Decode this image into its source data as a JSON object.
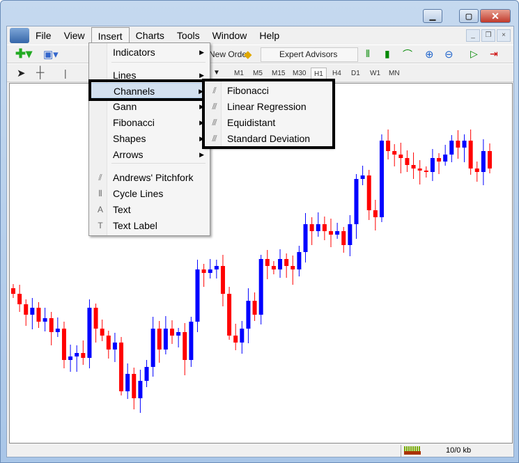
{
  "menubar": {
    "items": [
      "File",
      "View",
      "Insert",
      "Charts",
      "Tools",
      "Window",
      "Help"
    ],
    "open": "Insert"
  },
  "toolbar": {
    "new_order": "New Order",
    "expert_advisors": "Expert Advisors",
    "timeframes": [
      "M1",
      "M5",
      "M15",
      "M30",
      "H1",
      "H4",
      "D1",
      "W1",
      "MN"
    ],
    "selected_timeframe": "H1"
  },
  "insert_menu": {
    "items": [
      {
        "label": "Indicators",
        "submenu": true
      },
      {
        "label": "Lines",
        "submenu": true
      },
      {
        "label": "Channels",
        "submenu": true,
        "highlighted": true
      },
      {
        "label": "Gann",
        "submenu": true
      },
      {
        "label": "Fibonacci",
        "submenu": true
      },
      {
        "label": "Shapes",
        "submenu": true
      },
      {
        "label": "Arrows",
        "submenu": true
      },
      {
        "label": "Andrews' Pitchfork",
        "icon": "pitchfork-icon"
      },
      {
        "label": "Cycle Lines",
        "icon": "cycle-lines-icon"
      },
      {
        "label": "Text",
        "icon": "text-icon"
      },
      {
        "label": "Text Label",
        "icon": "text-label-icon"
      }
    ]
  },
  "channels_submenu": {
    "items": [
      {
        "label": "Fibonacci",
        "icon": "fibonacci-channel-icon"
      },
      {
        "label": "Linear Regression",
        "icon": "linear-regression-icon"
      },
      {
        "label": "Equidistant",
        "icon": "equidistant-channel-icon"
      },
      {
        "label": "Standard Deviation",
        "icon": "standard-deviation-channel-icon"
      }
    ]
  },
  "status": {
    "traffic": "10/0 kb"
  },
  "colors": {
    "bull": "#0000ff",
    "bear": "#ff0000",
    "highlight": "#d3e0ef"
  },
  "chart_data": {
    "type": "candlestick",
    "closes": [
      220,
      205,
      190,
      200,
      180,
      185,
      165,
      170,
      125,
      130,
      135,
      128,
      200,
      170,
      160,
      140,
      150,
      80,
      105,
      70,
      95,
      115,
      170,
      140,
      170,
      160,
      165,
      125,
      180,
      255,
      250,
      255,
      260,
      220,
      160,
      150,
      170,
      210,
      190,
      270,
      260,
      255,
      270,
      260,
      255,
      280,
      320,
      310,
      320,
      310,
      305,
      310,
      290,
      320,
      385,
      390,
      340,
      330,
      440,
      425,
      420,
      415,
      405,
      400,
      397,
      395,
      415,
      410,
      420,
      440,
      430,
      440,
      400,
      395,
      425,
      400
    ]
  }
}
